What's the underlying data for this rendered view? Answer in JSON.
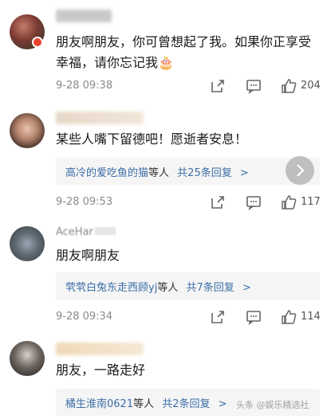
{
  "comments": [
    {
      "name_visible": "",
      "text": "朋友啊朋友，你可曾想起了我。如果你正享受幸福，请你忘记我",
      "emoji": "🎂",
      "time": "9-28 09:38",
      "likes": "204",
      "reply": null
    },
    {
      "name_visible": "",
      "text": "某些人嘴下留德吧！愿逝者安息！",
      "time": "9-28 09:53",
      "likes": "117",
      "reply": {
        "users": "高冷的爱吃鱼的猫",
        "suffix": "等人",
        "count_text": "共25条回复"
      }
    },
    {
      "name_visible": "AceHar",
      "text": "朋友啊朋友",
      "time": "9-28 09:34",
      "likes": "114",
      "reply": {
        "users": "茕茕白兔东走西顾yj",
        "suffix": "等人",
        "count_text": "共7条回复"
      }
    },
    {
      "name_visible": "",
      "text": "朋友，一路走好",
      "reply": {
        "users": "橘生淮南0621",
        "suffix": "等人",
        "count_text": "共2条回复"
      }
    }
  ],
  "reply_arrow": ">",
  "watermark": "头条 @娱乐精选社",
  "icons": [
    "share-icon",
    "comment-icon",
    "like-icon",
    "chevron-right-icon"
  ]
}
